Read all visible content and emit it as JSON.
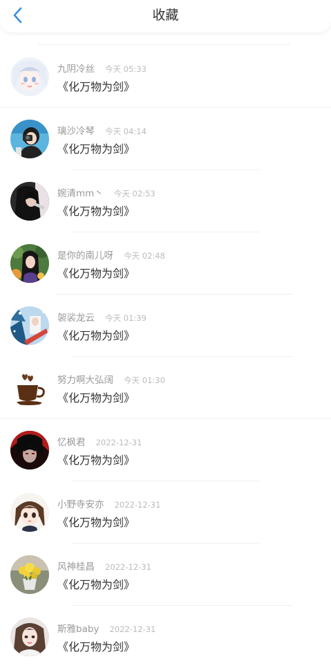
{
  "header": {
    "title": "收藏",
    "back_icon": "chevron-left-icon",
    "accent": "#3a8ee6"
  },
  "items": [
    {
      "name": "九阴冷丝",
      "time": "今天 05:33",
      "title": "《化万物为剑》",
      "avatar": "anime-girl-white-hair"
    },
    {
      "name": "璃沙冷琴",
      "time": "今天 04:14",
      "title": "《化万物为剑》",
      "avatar": "girl-with-camera"
    },
    {
      "name": "婉清mm丶",
      "time": "今天 02:53",
      "title": "《化万物为剑》",
      "avatar": "dark-haired-girl"
    },
    {
      "name": "是你的南儿呀",
      "time": "今天 02:48",
      "title": "《化万物为剑》",
      "avatar": "girl-in-garden"
    },
    {
      "name": "袈裟龙云",
      "time": "今天 01:39",
      "title": "《化万物为剑》",
      "avatar": "winter-street"
    },
    {
      "name": "努力啊大弘阔",
      "time": "今天 01:30",
      "title": "《化万物为剑》",
      "avatar": "coffee-bean-cup"
    },
    {
      "name": "忆枫君",
      "time": "2022-12-31",
      "title": "《化万物为剑》",
      "avatar": "red-black-anime"
    },
    {
      "name": "小野寺安亦",
      "time": "2022-12-31",
      "title": "《化万物为剑》",
      "avatar": "anime-girl-brown-hair"
    },
    {
      "name": "风神桂昌",
      "time": "2022-12-31",
      "title": "《化万物为剑》",
      "avatar": "yellow-flowers"
    },
    {
      "name": "斯雅baby",
      "time": "2022-12-31",
      "title": "《化万物为剑》",
      "avatar": "portrait-girl"
    }
  ]
}
